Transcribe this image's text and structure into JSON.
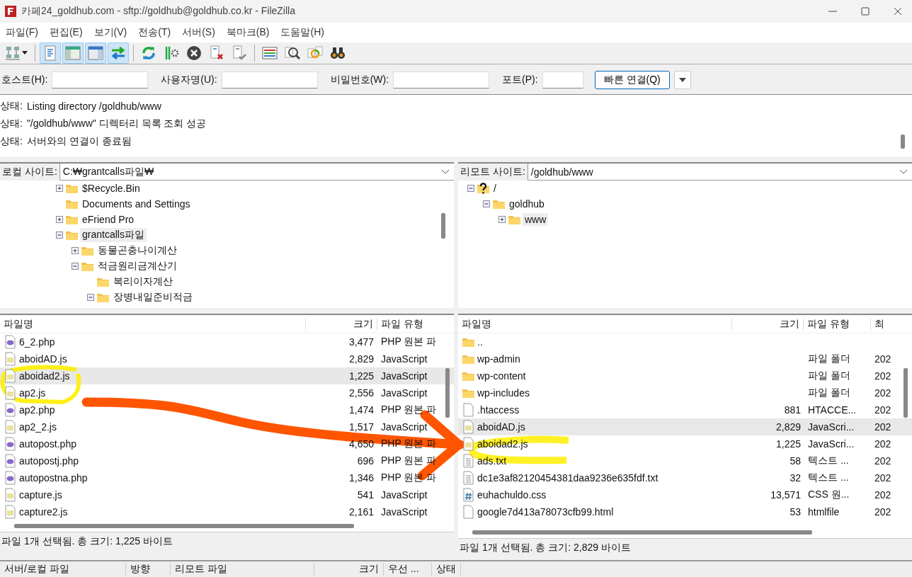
{
  "window": {
    "title": "카페24_goldhub.com - sftp://goldhub@goldhub.co.kr - FileZilla"
  },
  "menu": [
    "파일(F)",
    "편집(E)",
    "보기(V)",
    "전송(T)",
    "서버(S)",
    "북마크(B)",
    "도움말(H)"
  ],
  "toolbar": [
    {
      "kind": "sitemanager",
      "on": false
    },
    {
      "kind": "log",
      "on": true
    },
    {
      "kind": "localtree",
      "on": true
    },
    {
      "kind": "remotetree",
      "on": true
    },
    {
      "kind": "queue",
      "on": true
    },
    {
      "kind": "refresh",
      "on": false
    },
    {
      "kind": "process",
      "on": false
    },
    {
      "kind": "cancel",
      "on": false
    },
    {
      "kind": "disconnect",
      "on": false
    },
    {
      "kind": "reconnect",
      "on": false
    },
    {
      "kind": "filter",
      "on": false
    },
    {
      "kind": "compare",
      "on": false
    },
    {
      "kind": "sync",
      "on": false
    },
    {
      "kind": "find",
      "on": false
    }
  ],
  "quickconnect": {
    "fields": [
      {
        "label": "호스트(H):",
        "kind": "wide"
      },
      {
        "label": "사용자명(U):",
        "kind": "wide"
      },
      {
        "label": "비밀번호(W):",
        "kind": "wide"
      },
      {
        "label": "포트(P):",
        "kind": "narrow"
      }
    ],
    "button": "빠른 연결(Q)"
  },
  "log": [
    {
      "label": "상태:",
      "message": "Listing directory /goldhub/www"
    },
    {
      "label": "상태:",
      "message": "\"/goldhub/www\" 디렉터리 목록 조회 성공"
    },
    {
      "label": "상태:",
      "message": "서버와의 연결이 종료됨"
    }
  ],
  "local": {
    "site_label": "로컬 사이트:",
    "path": "C:₩grantcalls파일₩",
    "tree": [
      {
        "name": "$Recycle.Bin",
        "expandable": true,
        "expanded": false,
        "selected": false
      },
      {
        "name": "Documents and Settings",
        "expandable": false,
        "selected": false
      },
      {
        "name": "eFriend Pro",
        "expandable": true,
        "expanded": false,
        "selected": false
      },
      {
        "name": "grantcalls파일",
        "expandable": true,
        "expanded": true,
        "selected": true,
        "children": [
          {
            "name": "동물곤충나이계산",
            "expandable": true,
            "expanded": false,
            "selected": false
          },
          {
            "name": "적금원리금계산기",
            "expandable": true,
            "expanded": true,
            "selected": false,
            "children": [
              {
                "name": "복리이자계산",
                "expandable": false,
                "selected": false
              },
              {
                "name": "장병내일준비적금",
                "expandable": true,
                "expanded": true,
                "selected": false
              }
            ]
          }
        ]
      }
    ],
    "columns": [
      "파일명",
      "크기",
      "파일 유형"
    ],
    "files": [
      {
        "name": "6_2.php",
        "size": "3,477",
        "type": "PHP 원본 파",
        "kind": "php",
        "selected": false
      },
      {
        "name": "aboidAD.js",
        "size": "2,829",
        "type": "JavaScript",
        "kind": "js",
        "selected": false
      },
      {
        "name": "aboidad2.js",
        "size": "1,225",
        "type": "JavaScript",
        "kind": "js",
        "selected": true
      },
      {
        "name": "ap2.js",
        "size": "2,556",
        "type": "JavaScript",
        "kind": "js",
        "selected": false
      },
      {
        "name": "ap2.php",
        "size": "1,474",
        "type": "PHP 원본 파",
        "kind": "php",
        "selected": false
      },
      {
        "name": "ap2_2.js",
        "size": "1,517",
        "type": "JavaScript",
        "kind": "js",
        "selected": false
      },
      {
        "name": "autopost.php",
        "size": "4,650",
        "type": "PHP 원본 파",
        "kind": "php",
        "selected": false
      },
      {
        "name": "autopostj.php",
        "size": "696",
        "type": "PHP 원본 파",
        "kind": "php",
        "selected": false
      },
      {
        "name": "autopostna.php",
        "size": "1,346",
        "type": "PHP 원본 파",
        "kind": "php",
        "selected": false
      },
      {
        "name": "capture.js",
        "size": "541",
        "type": "JavaScript",
        "kind": "js",
        "selected": false
      },
      {
        "name": "capture2.js",
        "size": "2,161",
        "type": "JavaScript",
        "kind": "js",
        "selected": false
      }
    ],
    "status": "파일 1개 선택됨. 총 크기: 1,225 바이트"
  },
  "remote": {
    "site_label": "리모트 사이트:",
    "path": "/goldhub/www",
    "tree": [
      {
        "name": "/",
        "expandable": true,
        "expanded": true,
        "selected": false,
        "kind": "unknown",
        "children": [
          {
            "name": "goldhub",
            "expandable": true,
            "expanded": true,
            "selected": false,
            "children": [
              {
                "name": "www",
                "expandable": true,
                "expanded": false,
                "selected": true
              }
            ]
          }
        ]
      }
    ],
    "columns": [
      "파일명",
      "크기",
      "파일 유형",
      "최"
    ],
    "files": [
      {
        "name": "..",
        "kind": "folder",
        "selected": false
      },
      {
        "name": "wp-admin",
        "type": "파일 폴더",
        "column_4": "202",
        "kind": "folder",
        "selected": false
      },
      {
        "name": "wp-content",
        "type": "파일 폴더",
        "column_4": "202",
        "kind": "folder",
        "selected": false
      },
      {
        "name": "wp-includes",
        "type": "파일 폴더",
        "column_4": "202",
        "kind": "folder",
        "selected": false
      },
      {
        "name": ".htaccess",
        "size": "881",
        "type": "HTACCE...",
        "column_4": "202",
        "kind": "blank",
        "selected": false
      },
      {
        "name": "aboidAD.js",
        "size": "2,829",
        "type": "JavaScri...",
        "column_4": "202",
        "kind": "js",
        "selected": true
      },
      {
        "name": "aboidad2.js",
        "size": "1,225",
        "type": "JavaScri...",
        "column_4": "202",
        "kind": "js",
        "selected": false
      },
      {
        "name": "ads.txt",
        "size": "58",
        "type": "텍스트 ...",
        "column_4": "202",
        "kind": "txt",
        "selected": false
      },
      {
        "name": "dc1e3af82120454381daa9236e635fdf.txt",
        "size": "32",
        "type": "텍스트 ...",
        "column_4": "202",
        "kind": "txt",
        "selected": false
      },
      {
        "name": "euhachuldo.css",
        "size": "13,571",
        "type": "CSS 원...",
        "column_4": "202",
        "kind": "css",
        "selected": false
      },
      {
        "name": "google7d413a78073cfb99.html",
        "size": "53",
        "type": "htmlfile",
        "column_4": "202",
        "kind": "blank",
        "selected": false
      }
    ],
    "status": "파일 1개 선택됨. 총 크기: 2,829 바이트"
  },
  "queue": {
    "columns": [
      "서버/로컬 파일",
      "방향",
      "리모트 파일",
      "크기",
      "우선 ...",
      "상태"
    ]
  },
  "annotations": [
    {
      "kind": "highlight"
    },
    {
      "kind": "highlight"
    },
    {
      "kind": "arrow"
    }
  ]
}
